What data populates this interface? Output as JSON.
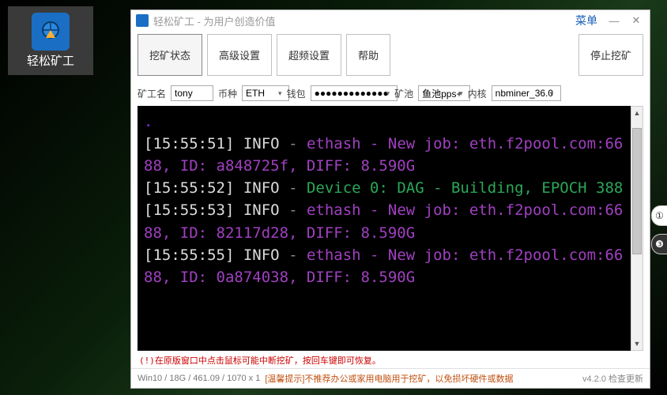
{
  "desktop": {
    "label": "轻松矿工"
  },
  "window": {
    "title": "轻松矿工 - 为用户创造价值",
    "menu_label": "菜单"
  },
  "tabs": {
    "mining": "挖矿状态",
    "advanced": "高级设置",
    "overclock": "超频设置",
    "help": "帮助",
    "stop": "停止挖矿"
  },
  "params": {
    "miner_label": "矿工名",
    "miner_value": "tony",
    "coin_label": "币种",
    "coin_value": "ETH",
    "wallet_label": "钱包",
    "wallet_value": "●●●●●●●●●●●●●",
    "pool_label": "矿池",
    "pool_value": "鱼池pps+",
    "kernel_label": "内核",
    "kernel_value": "nbminer_36.0"
  },
  "console": {
    "lines": [
      {
        "ts": "[15:55:51]",
        "lvl": "INFO",
        "kind": "eth",
        "txt": "ethash - New job: eth.f2pool.com:6688, ID: a848725f, DIFF: 8.590G"
      },
      {
        "ts": "[15:55:52]",
        "lvl": "INFO",
        "kind": "dev",
        "txt": "Device 0: DAG - Building, EPOCH 388"
      },
      {
        "ts": "[15:55:53]",
        "lvl": "INFO",
        "kind": "eth",
        "txt": "ethash - New job: eth.f2pool.com:6688, ID: 82117d28, DIFF: 8.590G"
      },
      {
        "ts": "[15:55:55]",
        "lvl": "INFO",
        "kind": "eth",
        "txt": "ethash - New job: eth.f2pool.com:6688, ID: 0a874038, DIFF: 8.590G"
      }
    ],
    "footer_warn": "(!)在原版窗口中点击鼠标可能中断挖矿，按回车键即可恢复。"
  },
  "status": {
    "sys": "Win10 / 18G / 461.09 / 1070 x 1",
    "tip": "[温馨提示]不推荐办公或家用电脑用于挖矿，以免损坏硬件或数据",
    "version": "v4.2.0 检查更新"
  }
}
